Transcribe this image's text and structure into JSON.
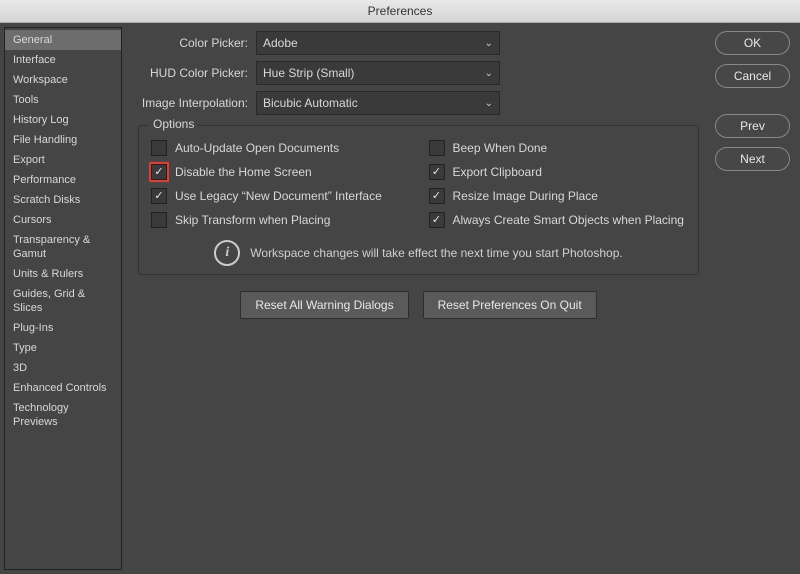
{
  "title": "Preferences",
  "sidebar": [
    "General",
    "Interface",
    "Workspace",
    "Tools",
    "History Log",
    "File Handling",
    "Export",
    "Performance",
    "Scratch Disks",
    "Cursors",
    "Transparency & Gamut",
    "Units & Rulers",
    "Guides, Grid & Slices",
    "Plug-Ins",
    "Type",
    "3D",
    "Enhanced Controls",
    "Technology Previews"
  ],
  "sidebar_selected": 0,
  "form": {
    "color_picker": {
      "label": "Color Picker:",
      "value": "Adobe"
    },
    "hud": {
      "label": "HUD Color Picker:",
      "value": "Hue Strip (Small)"
    },
    "interp": {
      "label": "Image Interpolation:",
      "value": "Bicubic Automatic"
    }
  },
  "options_legend": "Options",
  "options": {
    "auto_update": {
      "label": "Auto-Update Open Documents",
      "checked": false
    },
    "beep": {
      "label": "Beep When Done",
      "checked": false
    },
    "disable_home": {
      "label": "Disable the Home Screen",
      "checked": true,
      "highlight": true
    },
    "export_clip": {
      "label": "Export Clipboard",
      "checked": true
    },
    "legacy_newdoc": {
      "label": "Use Legacy “New Document” Interface",
      "checked": true
    },
    "resize_place": {
      "label": "Resize Image During Place",
      "checked": true
    },
    "skip_transform": {
      "label": "Skip Transform when Placing",
      "checked": false
    },
    "smart_objects": {
      "label": "Always Create Smart Objects when Placing",
      "checked": true
    }
  },
  "info_text": "Workspace changes will take effect the next time you start Photoshop.",
  "reset_warnings": "Reset All Warning Dialogs",
  "reset_prefs": "Reset Preferences On Quit",
  "actions": {
    "ok": "OK",
    "cancel": "Cancel",
    "prev": "Prev",
    "next": "Next"
  }
}
